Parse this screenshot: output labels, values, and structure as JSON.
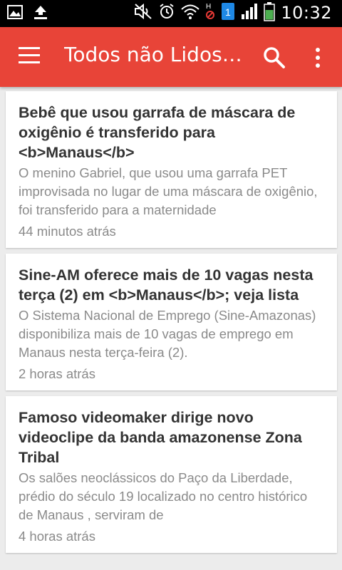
{
  "status_bar": {
    "time": "10:32",
    "icons": [
      "image-icon",
      "download-icon",
      "mute-icon",
      "alarm-icon",
      "wifi-icon",
      "no-data-icon",
      "sim-icon",
      "signal-icon",
      "battery-icon"
    ],
    "sim_number": "1",
    "battery_color": "#4caf50"
  },
  "app_bar": {
    "title": "Todos não Lidos Manaus",
    "color": "#e84438",
    "icons": [
      "menu-icon",
      "search-icon",
      "more-vert-icon"
    ]
  },
  "articles": [
    {
      "title": "Bebê que usou garrafa de máscara de oxigênio é transferido para <b>Manaus</b>",
      "description": "O menino Gabriel, que usou uma garrafa PET improvisada no lugar de uma máscara de oxigênio, foi transferido para a maternidade",
      "time": "44 minutos atrás"
    },
    {
      "title": "Sine-AM oferece mais de 10 vagas nesta terça (2) em <b>Manaus</b>; veja lista",
      "description": "O Sistema Nacional de Emprego (Sine-Amazonas) disponibiliza mais de 10 vagas de emprego em Manaus nesta terça-feira (2).",
      "time": "2 horas atrás"
    },
    {
      "title": "Famoso videomaker dirige novo videoclipe da banda amazonense Zona Tribal",
      "description": "Os salões neoclássicos do Paço da Liberdade, prédio do século 19 localizado no centro histórico de Manaus , serviram de",
      "time": "4 horas atrás"
    }
  ]
}
